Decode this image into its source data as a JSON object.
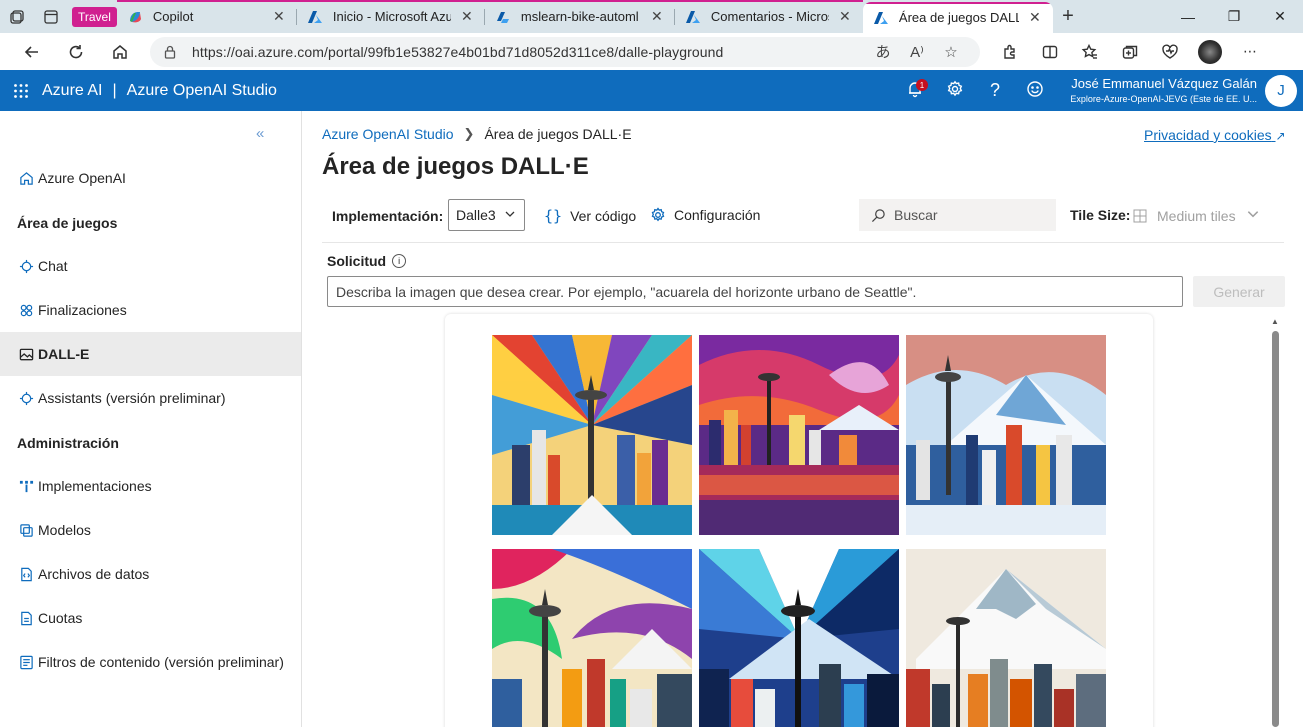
{
  "browser": {
    "tab_group_label": "Travel",
    "tabs": [
      {
        "label": "Copilot",
        "icon": "copilot-icon"
      },
      {
        "label": "Inicio - Microsoft Azure",
        "icon": "azure-icon"
      },
      {
        "label": "mslearn-bike-automl - ",
        "icon": "azure-ml-icon"
      },
      {
        "label": "Comentarios - Microsof",
        "icon": "azure-icon"
      },
      {
        "label": "Área de juegos DALL·E",
        "icon": "azure-icon"
      }
    ],
    "url": "https://oai.azure.com/portal/99fb1e53827e4b01bd71d8052d311ce8/dalle-playground"
  },
  "header": {
    "product": "Azure AI",
    "separator": "|",
    "studio": "Azure OpenAI Studio",
    "notification_count": "1",
    "user_name": "José Emmanuel Vázquez Galán",
    "user_subtitle": "Explore-Azure-OpenAI-JEVG (Este de EE. U...",
    "avatar_initial": "J"
  },
  "sidebar": {
    "items": [
      {
        "label": "Azure OpenAI",
        "icon": "home-icon"
      },
      {
        "label": "Chat",
        "icon": "chat-icon"
      },
      {
        "label": "Finalizaciones",
        "icon": "completions-icon"
      },
      {
        "label": "DALL-E",
        "icon": "image-icon"
      },
      {
        "label": "Assistants (versión preliminar)",
        "icon": "assistants-icon"
      },
      {
        "label": "Implementaciones",
        "icon": "deployments-icon"
      },
      {
        "label": "Modelos",
        "icon": "models-icon"
      },
      {
        "label": "Archivos de datos",
        "icon": "data-files-icon"
      },
      {
        "label": "Cuotas",
        "icon": "quotas-icon"
      },
      {
        "label": "Filtros de contenido (versión preliminar)",
        "icon": "content-filters-icon"
      }
    ],
    "section_playground": "Área de juegos",
    "section_admin": "Administración"
  },
  "main": {
    "breadcrumb_root": "Azure OpenAI Studio",
    "breadcrumb_current": "Área de juegos DALL·E",
    "privacy_link": "Privacidad y cookies",
    "title": "Área de juegos DALL·E",
    "deployment_label": "Implementación:",
    "deployment_value": "Dalle3",
    "view_code": "Ver código",
    "settings": "Configuración",
    "search_placeholder": "Buscar",
    "tile_size_label": "Tile Size:",
    "tile_size_value": "Medium tiles",
    "prompt_label": "Solicitud",
    "prompt_placeholder": "Describa la imagen que desea crear. Por ejemplo, \"acuarela del horizonte urbano de Seattle\".",
    "generate_button": "Generar"
  },
  "colors": {
    "azure_blue": "#0f6cbd",
    "tab_group": "#d02090",
    "nav_active_bg": "#ebebeb"
  }
}
